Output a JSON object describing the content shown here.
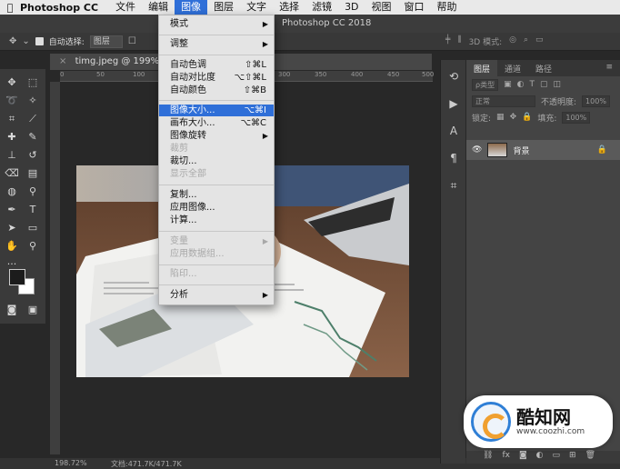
{
  "menubar": {
    "apple_icon": "apple-icon",
    "app_name": "Photoshop CC",
    "items": [
      {
        "label": "文件"
      },
      {
        "label": "编辑"
      },
      {
        "label": "图像"
      },
      {
        "label": "图层"
      },
      {
        "label": "文字"
      },
      {
        "label": "选择"
      },
      {
        "label": "滤镜"
      },
      {
        "label": "3D"
      },
      {
        "label": "视图"
      },
      {
        "label": "窗口"
      },
      {
        "label": "帮助"
      }
    ],
    "active_index": 2
  },
  "window": {
    "title": "Photoshop CC 2018"
  },
  "options_bar": {
    "auto_select_label": "自动选择:",
    "auto_select_value": "图层",
    "mode_3d_label": "3D 模式:"
  },
  "document": {
    "tab_title": "timg.jpeg @ 199%(RGB/",
    "ruler_ticks": [
      "0",
      "50",
      "100",
      "150",
      "200",
      "250",
      "300",
      "350",
      "400",
      "450",
      "500"
    ]
  },
  "status_bar": {
    "zoom": "198.72%",
    "doc_info": "文档:471.7K/471.7K"
  },
  "image_menu": {
    "items": [
      {
        "label": "模式",
        "shortcut": "",
        "submenu": true,
        "disabled": false
      },
      {
        "label": "调整",
        "shortcut": "",
        "submenu": true,
        "disabled": false
      },
      {
        "label": "自动色调",
        "shortcut": "⇧⌘L",
        "submenu": false,
        "disabled": false
      },
      {
        "label": "自动对比度",
        "shortcut": "⌥⇧⌘L",
        "submenu": false,
        "disabled": false
      },
      {
        "label": "自动颜色",
        "shortcut": "⇧⌘B",
        "submenu": false,
        "disabled": false
      },
      {
        "label": "图像大小...",
        "shortcut": "⌥⌘I",
        "submenu": false,
        "disabled": false,
        "highlighted": true
      },
      {
        "label": "画布大小...",
        "shortcut": "⌥⌘C",
        "submenu": false,
        "disabled": false
      },
      {
        "label": "图像旋转",
        "shortcut": "",
        "submenu": true,
        "disabled": false
      },
      {
        "label": "裁剪",
        "shortcut": "",
        "submenu": false,
        "disabled": true
      },
      {
        "label": "裁切...",
        "shortcut": "",
        "submenu": false,
        "disabled": false
      },
      {
        "label": "显示全部",
        "shortcut": "",
        "submenu": false,
        "disabled": true
      },
      {
        "label": "复制...",
        "shortcut": "",
        "submenu": false,
        "disabled": false
      },
      {
        "label": "应用图像...",
        "shortcut": "",
        "submenu": false,
        "disabled": false
      },
      {
        "label": "计算...",
        "shortcut": "",
        "submenu": false,
        "disabled": false
      },
      {
        "label": "变量",
        "shortcut": "",
        "submenu": true,
        "disabled": true
      },
      {
        "label": "应用数据组...",
        "shortcut": "",
        "submenu": false,
        "disabled": true
      },
      {
        "label": "陷印...",
        "shortcut": "",
        "submenu": false,
        "disabled": true
      },
      {
        "label": "分析",
        "shortcut": "",
        "submenu": true,
        "disabled": false
      }
    ]
  },
  "layers_panel": {
    "tabs": [
      {
        "label": "图层"
      },
      {
        "label": "通道"
      },
      {
        "label": "路径"
      }
    ],
    "active_tab": 0,
    "filter_label": "ρ类型",
    "blend_mode": "正常",
    "opacity_label": "不透明度:",
    "opacity_value": "100%",
    "lock_label": "锁定:",
    "fill_label": "填充:",
    "fill_value": "100%",
    "layers": [
      {
        "name": "背景",
        "visible": true,
        "locked": true
      }
    ],
    "footer_icons": [
      "link-icon",
      "fx-icon",
      "mask-icon",
      "adjustment-icon",
      "folder-icon",
      "new-layer-icon",
      "trash-icon"
    ]
  },
  "watermark": {
    "title": "酷知网",
    "url": "www.coozhi.com"
  },
  "colors": {
    "menu_highlight": "#2f6fd8",
    "panel_bg": "#444444",
    "canvas_bg": "#282828"
  }
}
